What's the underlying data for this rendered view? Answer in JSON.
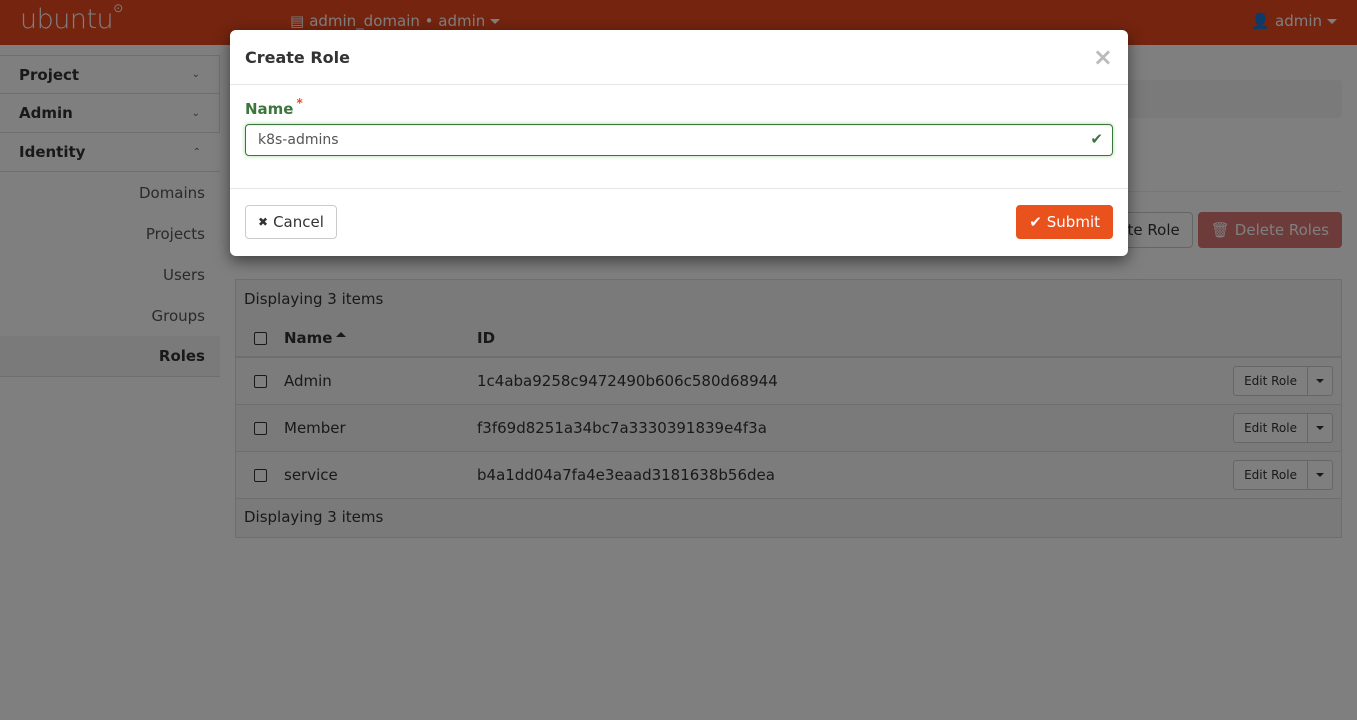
{
  "navbar": {
    "brand": "ubuntu",
    "brand_mark": "®",
    "context_icon": "list-alt-icon",
    "context_label": "admin_domain • admin",
    "user_icon": "user-icon",
    "user_label": "admin",
    "color": "#e9481f"
  },
  "sidebar": {
    "panels": [
      {
        "label": "Project",
        "chevron": "chevron-down-icon"
      },
      {
        "label": "Admin",
        "chevron": "chevron-down-icon"
      },
      {
        "label": "Identity",
        "chevron": "chevron-up-icon"
      }
    ],
    "items": [
      {
        "label": "Domains"
      },
      {
        "label": "Projects"
      },
      {
        "label": "Users"
      },
      {
        "label": "Groups"
      },
      {
        "label": "Roles",
        "active": true
      }
    ]
  },
  "main": {
    "actions": {
      "create_label": "Create Role",
      "delete_label": "Delete Roles"
    },
    "table": {
      "caption": "Displaying 3 items",
      "footer": "Displaying 3 items",
      "columns": {
        "name": "Name",
        "id": "ID"
      },
      "rows": [
        {
          "name": "Admin",
          "id": "1c4aba9258c9472490b606c580d68944",
          "action": "Edit Role"
        },
        {
          "name": "Member",
          "id": "f3f69d8251a34bc7a3330391839e4f3a",
          "action": "Edit Role"
        },
        {
          "name": "service",
          "id": "b4a1dd04a7fa4e3eaad3181638b56dea",
          "action": "Edit Role"
        }
      ]
    }
  },
  "modal": {
    "title": "Create Role",
    "close_symbol": "×",
    "field_label": "Name",
    "required_mark": "*",
    "name_value": "k8s-admins",
    "valid_icon": "✔",
    "cancel_label": "Cancel",
    "cancel_icon": "✖",
    "submit_label": "Submit",
    "submit_icon": "✔",
    "submit_color": "#e9511d"
  }
}
